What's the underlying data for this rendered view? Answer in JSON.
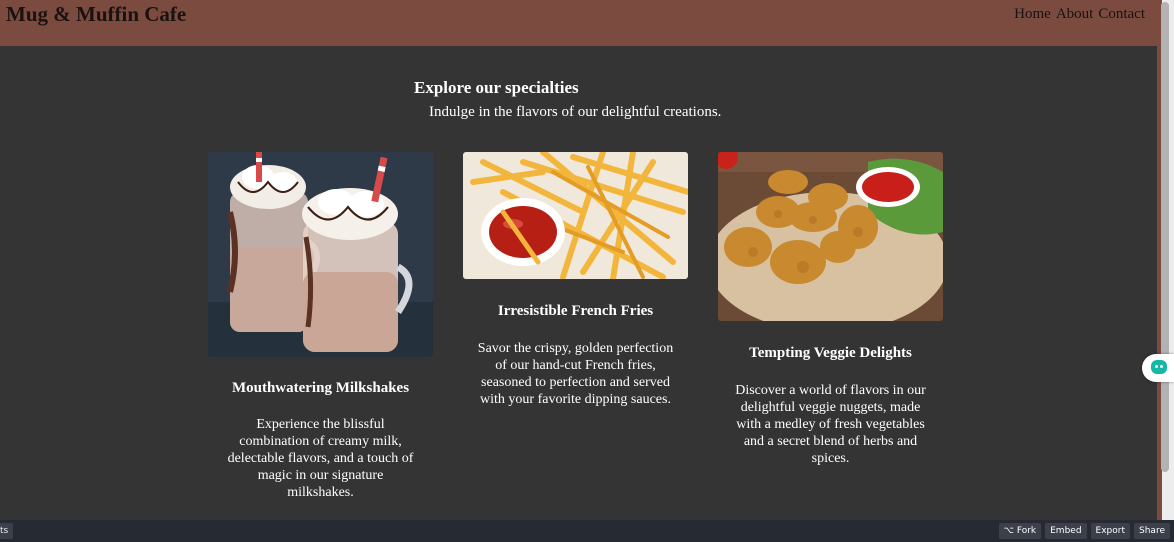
{
  "header": {
    "brand": "Mug & Muffin Cafe",
    "nav": [
      "Home",
      "About",
      "Contact"
    ]
  },
  "intro": {
    "title": "Explore our specialties",
    "subtitle": "Indulge in the flavors of our delightful creations."
  },
  "cards": [
    {
      "title": "Mouthwatering Milkshakes",
      "text": "Experience the blissful combination of creamy milk, delectable flavors, and a touch of magic in our signature milkshakes.",
      "image": "milkshake-photo"
    },
    {
      "title": "Irresistible French Fries",
      "text": "Savor the crispy, golden perfection of our hand-cut French fries, seasoned to perfection and served with your favorite dipping sauces.",
      "image": "french-fries-photo"
    },
    {
      "title": "Tempting Veggie Delights",
      "text": "Discover a world of flavors in our delightful veggie nuggets, made with a medley of fresh vegetables and a secret blend of herbs and spices.",
      "image": "veggie-nuggets-photo"
    }
  ],
  "footer": {
    "left_label": "ts",
    "buttons": [
      "⌥ Fork",
      "Embed",
      "Export",
      "Share"
    ]
  },
  "colors": {
    "header_bg": "#7b4b40",
    "page_bg": "#343434",
    "footer_bg": "#262a33",
    "chat_accent": "#14b8a6"
  }
}
